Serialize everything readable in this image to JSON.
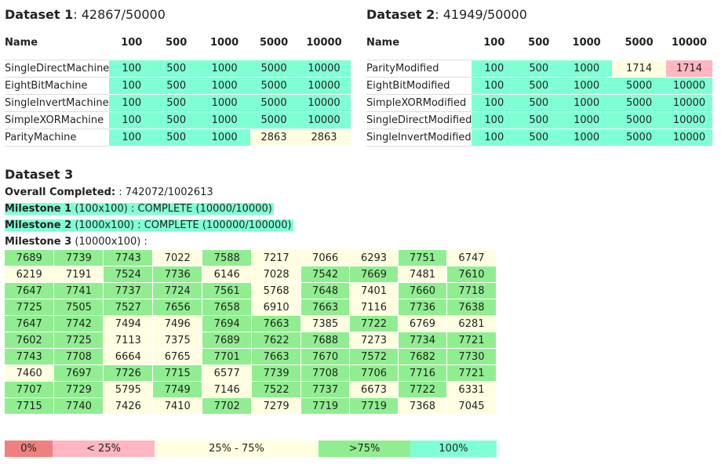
{
  "colors": {
    "full": "#7fffd4",
    "high": "#90ee90",
    "mid": "#fffee0",
    "low": "#ffb6c1",
    "zero": "#f08080"
  },
  "dataset1": {
    "title": "Dataset 1",
    "score": ": 42867/50000",
    "headers": [
      "Name",
      "100",
      "500",
      "1000",
      "5000",
      "10000"
    ],
    "rows": [
      {
        "name": "SingleDirectMachine",
        "values": [
          "100",
          "500",
          "1000",
          "5000",
          "10000"
        ],
        "levels": [
          "full",
          "full",
          "full",
          "full",
          "full"
        ]
      },
      {
        "name": "EightBitMachine",
        "values": [
          "100",
          "500",
          "1000",
          "5000",
          "10000"
        ],
        "levels": [
          "full",
          "full",
          "full",
          "full",
          "full"
        ]
      },
      {
        "name": "SingleInvertMachine",
        "values": [
          "100",
          "500",
          "1000",
          "5000",
          "10000"
        ],
        "levels": [
          "full",
          "full",
          "full",
          "full",
          "full"
        ]
      },
      {
        "name": "SimpleXORMachine",
        "values": [
          "100",
          "500",
          "1000",
          "5000",
          "10000"
        ],
        "levels": [
          "full",
          "full",
          "full",
          "full",
          "full"
        ]
      },
      {
        "name": "ParityMachine",
        "values": [
          "100",
          "500",
          "1000",
          "2863",
          "2863"
        ],
        "levels": [
          "full",
          "full",
          "full",
          "mid",
          "mid"
        ]
      }
    ]
  },
  "dataset2": {
    "title": "Dataset 2",
    "score": ": 41949/50000",
    "headers": [
      "Name",
      "100",
      "500",
      "1000",
      "5000",
      "10000"
    ],
    "rows": [
      {
        "name": "ParityModified",
        "values": [
          "100",
          "500",
          "1000",
          "1714",
          "1714"
        ],
        "levels": [
          "full",
          "full",
          "full",
          "mid",
          "low"
        ]
      },
      {
        "name": "EightBitModified",
        "values": [
          "100",
          "500",
          "1000",
          "5000",
          "10000"
        ],
        "levels": [
          "full",
          "full",
          "full",
          "full",
          "full"
        ]
      },
      {
        "name": "SimpleXORModified",
        "values": [
          "100",
          "500",
          "1000",
          "5000",
          "10000"
        ],
        "levels": [
          "full",
          "full",
          "full",
          "full",
          "full"
        ]
      },
      {
        "name": "SingleDirectModified",
        "values": [
          "100",
          "500",
          "1000",
          "5000",
          "10000"
        ],
        "levels": [
          "full",
          "full",
          "full",
          "full",
          "full"
        ]
      },
      {
        "name": "SingleInvertModified",
        "values": [
          "100",
          "500",
          "1000",
          "5000",
          "10000"
        ],
        "levels": [
          "full",
          "full",
          "full",
          "full",
          "full"
        ]
      }
    ]
  },
  "dataset3": {
    "title": "Dataset 3",
    "overall_label": "Overall Completed:",
    "overall_value": " : 742072/1002613",
    "milestone1_label": "Milestone 1",
    "milestone1_text": " (100x100) : COMPLETE (10000/10000)",
    "milestone2_label": "Milestone 2",
    "milestone2_text": " (1000x100) : COMPLETE (100000/100000)",
    "milestone3_label": "Milestone 3",
    "milestone3_text": " (10000x100) :",
    "grid": [
      [
        "7689",
        "7739",
        "7743",
        "7022",
        "7588",
        "7217",
        "7066",
        "6293",
        "7751",
        "6747"
      ],
      [
        "6219",
        "7191",
        "7524",
        "7736",
        "6146",
        "7028",
        "7542",
        "7669",
        "7481",
        "7610"
      ],
      [
        "7647",
        "7741",
        "7737",
        "7724",
        "7561",
        "5768",
        "7648",
        "7401",
        "7660",
        "7718"
      ],
      [
        "7725",
        "7505",
        "7527",
        "7656",
        "7658",
        "6910",
        "7663",
        "7116",
        "7736",
        "7638"
      ],
      [
        "7647",
        "7742",
        "7494",
        "7496",
        "7694",
        "7663",
        "7385",
        "7722",
        "6769",
        "6281"
      ],
      [
        "7602",
        "7725",
        "7113",
        "7375",
        "7689",
        "7622",
        "7688",
        "7273",
        "7734",
        "7721"
      ],
      [
        "7743",
        "7708",
        "6664",
        "6765",
        "7701",
        "7663",
        "7670",
        "7572",
        "7682",
        "7730"
      ],
      [
        "7460",
        "7697",
        "7726",
        "7715",
        "6577",
        "7739",
        "7708",
        "7706",
        "7716",
        "7721"
      ],
      [
        "7707",
        "7729",
        "5795",
        "7749",
        "7146",
        "7522",
        "7737",
        "6673",
        "7722",
        "6331"
      ],
      [
        "7715",
        "7740",
        "7426",
        "7410",
        "7702",
        "7279",
        "7719",
        "7719",
        "7368",
        "7045"
      ]
    ]
  },
  "legend": [
    {
      "label": "0%",
      "level": "zero"
    },
    {
      "label": "< 25%",
      "level": "low"
    },
    {
      "label": "25% - 75%",
      "level": "mid"
    },
    {
      "label": ">75%",
      "level": "high"
    },
    {
      "label": "100%",
      "level": "full"
    }
  ]
}
